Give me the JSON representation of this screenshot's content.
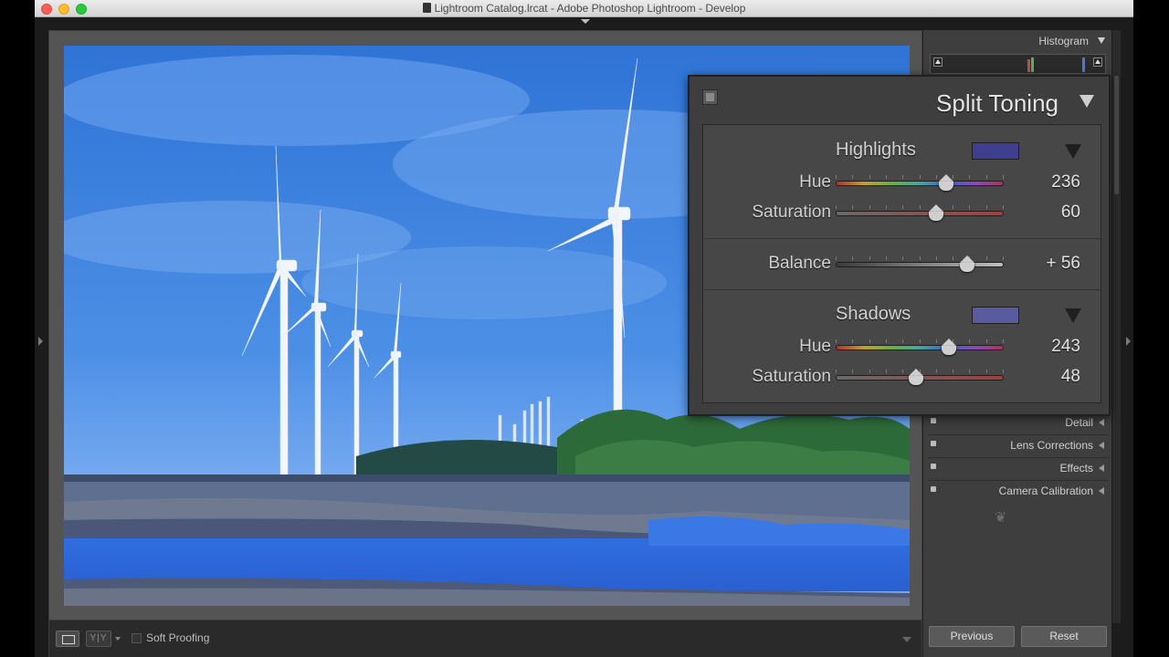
{
  "window": {
    "title": "Lightroom Catalog.lrcat - Adobe Photoshop Lightroom - Develop"
  },
  "toolbar": {
    "loupe_icon": "loupe-view-icon",
    "compare_label": "Y|Y",
    "soft_proofing_label": "Soft Proofing"
  },
  "right_panel": {
    "histogram_title": "Histogram",
    "panels": [
      {
        "label": "Detail"
      },
      {
        "label": "Lens Corrections"
      },
      {
        "label": "Effects"
      },
      {
        "label": "Camera Calibration"
      }
    ],
    "previous_label": "Previous",
    "reset_label": "Reset"
  },
  "split_toning": {
    "title": "Split Toning",
    "highlights": {
      "label": "Highlights",
      "swatch_color": "#3f3f8f",
      "hue_label": "Hue",
      "hue_value": "236",
      "hue_fraction": 0.656,
      "saturation_label": "Saturation",
      "saturation_value": "60",
      "saturation_fraction": 0.6
    },
    "balance": {
      "label": "Balance",
      "value": "+ 56",
      "fraction": 0.78
    },
    "shadows": {
      "label": "Shadows",
      "swatch_color": "#5a5a9e",
      "hue_label": "Hue",
      "hue_value": "243",
      "hue_fraction": 0.675,
      "saturation_label": "Saturation",
      "saturation_value": "48",
      "saturation_fraction": 0.48
    }
  }
}
